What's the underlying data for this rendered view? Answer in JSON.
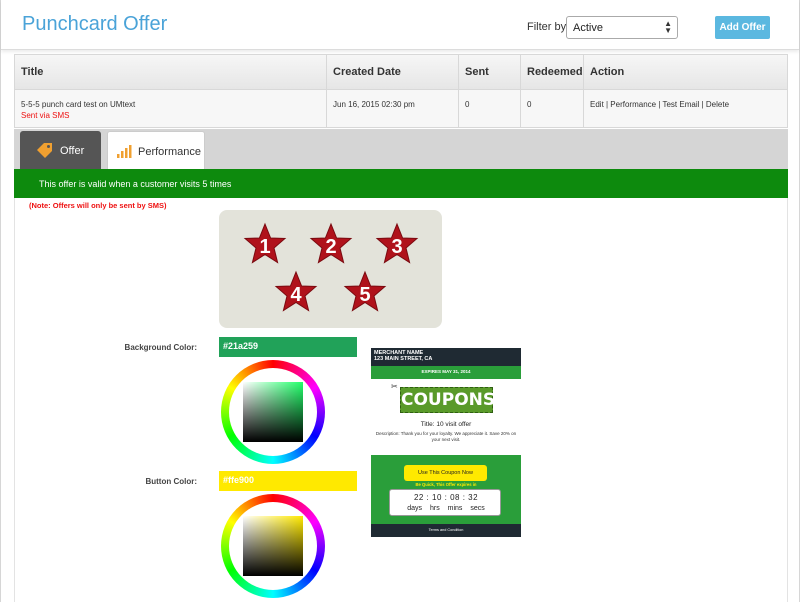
{
  "header": {
    "title": "Punchcard Offer",
    "filter_label": "Filter by",
    "filter_value": "Active",
    "add_button": "Add Offer"
  },
  "table": {
    "columns": [
      "Title",
      "Created Date",
      "Sent",
      "Redeemed",
      "Action"
    ],
    "rows": [
      {
        "title": "5-5-5 punch card test on UMtext",
        "subtitle": "Sent via SMS",
        "created": "Jun 16, 2015 02:30 pm",
        "sent": "0",
        "redeemed": "0",
        "actions": "Edit | Performance | Test Email | Delete"
      }
    ]
  },
  "tabs": [
    {
      "label": "Offer",
      "icon": "tag-icon",
      "active": true
    },
    {
      "label": "Performance",
      "icon": "bar-chart-icon",
      "active": false
    }
  ],
  "banner": "This offer is valid when a customer visits 5 times",
  "note": "(Note: Offers will only be sent by SMS)",
  "stars": [
    "1",
    "2",
    "3",
    "4",
    "5"
  ],
  "background_color": {
    "label": "Background Color:",
    "value": "#21a259"
  },
  "button_color": {
    "label": "Button Color:",
    "value": "#ffe900"
  },
  "colors": {
    "accent": "#4aa3d8",
    "banner": "#0d8a0d",
    "star": "#b0121b",
    "alert": "#ee1111"
  },
  "coupon": {
    "merchant": "MERCHANT NAME",
    "address": "123 MAIN STREET, CA",
    "expires": "EXPIRES MAY 31, 2014",
    "logo": "COUPONS",
    "title": "Title: 10 visit offer",
    "description": "Description: Thank you for your loyalty. We appreciate it. Save 20% on your next visit.",
    "use_button": "Use This Coupon Now",
    "hurry": "Be Quick, This Offer expires in",
    "time": "22 : 10 : 08 : 32",
    "units": "days hrs mins secs",
    "footer": "Terms and Condition"
  }
}
